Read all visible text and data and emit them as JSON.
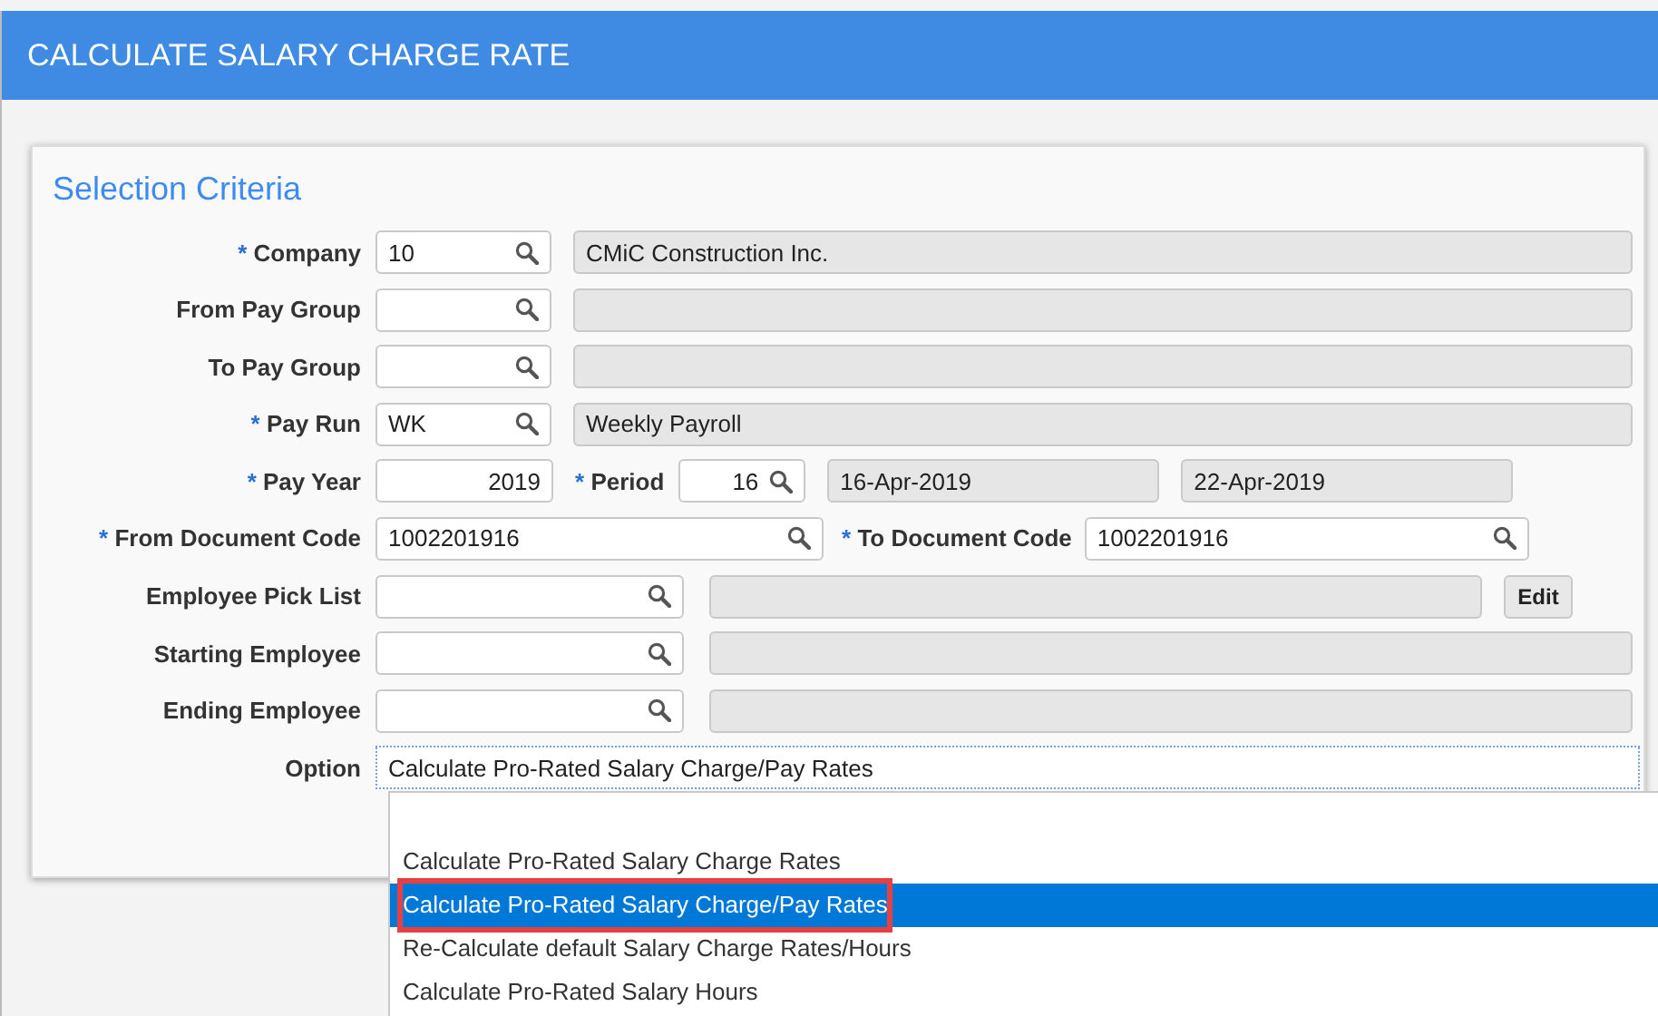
{
  "header": {
    "title": "CALCULATE SALARY CHARGE RATE"
  },
  "section": {
    "title": "Selection Criteria"
  },
  "rows": [
    {
      "label": "Company",
      "marker": "*",
      "items": [
        {
          "kind": "lookup",
          "value": "10"
        },
        {
          "kind": "display",
          "value": "CMiC Construction Inc."
        }
      ]
    },
    {
      "label": "From Pay Group",
      "items": [
        {
          "kind": "lookup"
        },
        {
          "kind": "display"
        }
      ]
    },
    {
      "label": "To Pay Group",
      "items": [
        {
          "kind": "lookup"
        },
        {
          "kind": "display"
        }
      ]
    },
    {
      "label": "Pay Run",
      "marker": "*",
      "items": [
        {
          "kind": "lookup",
          "value": "WK"
        },
        {
          "kind": "display",
          "value": "Weekly Payroll"
        }
      ]
    },
    {
      "label": "Pay Year",
      "marker": "*",
      "items": [
        {
          "kind": "number",
          "value": "2019"
        },
        {
          "kind": "label",
          "marker": "*",
          "text": "Period"
        },
        {
          "kind": "numlookup",
          "value": "16"
        },
        {
          "kind": "display",
          "value": "16-Apr-2019"
        },
        {
          "kind": "display",
          "value": "22-Apr-2019"
        }
      ]
    },
    {
      "label": "From Document Code",
      "marker": "*",
      "items": [
        {
          "kind": "lookup",
          "value": "1002201916"
        },
        {
          "kind": "label",
          "marker": "*",
          "text": "To Document Code"
        },
        {
          "kind": "lookup",
          "value": "1002201916"
        }
      ]
    },
    {
      "label": "Employee Pick List",
      "items": [
        {
          "kind": "lookup"
        },
        {
          "kind": "display"
        },
        {
          "kind": "button",
          "text": "Edit"
        }
      ]
    },
    {
      "label": "Starting Employee",
      "items": [
        {
          "kind": "lookup"
        },
        {
          "kind": "display"
        }
      ]
    },
    {
      "label": "Ending Employee",
      "items": [
        {
          "kind": "lookup"
        },
        {
          "kind": "display"
        }
      ]
    },
    {
      "label": "Option",
      "items": [
        {
          "kind": "select",
          "value": "Calculate Pro-Rated Salary Charge/Pay Rates"
        }
      ]
    }
  ],
  "dropdown": {
    "options": [
      {
        "text": "Calculate Pro-Rated Salary Charge Rates",
        "selected": false,
        "highlighted": false
      },
      {
        "text": "Calculate Pro-Rated Salary Charge/Pay Rates",
        "selected": true,
        "highlighted": true
      },
      {
        "text": "Re-Calculate default Salary Charge Rates/Hours",
        "selected": false,
        "highlighted": false
      },
      {
        "text": "Calculate Pro-Rated Salary Hours",
        "selected": false,
        "highlighted": false
      }
    ]
  }
}
